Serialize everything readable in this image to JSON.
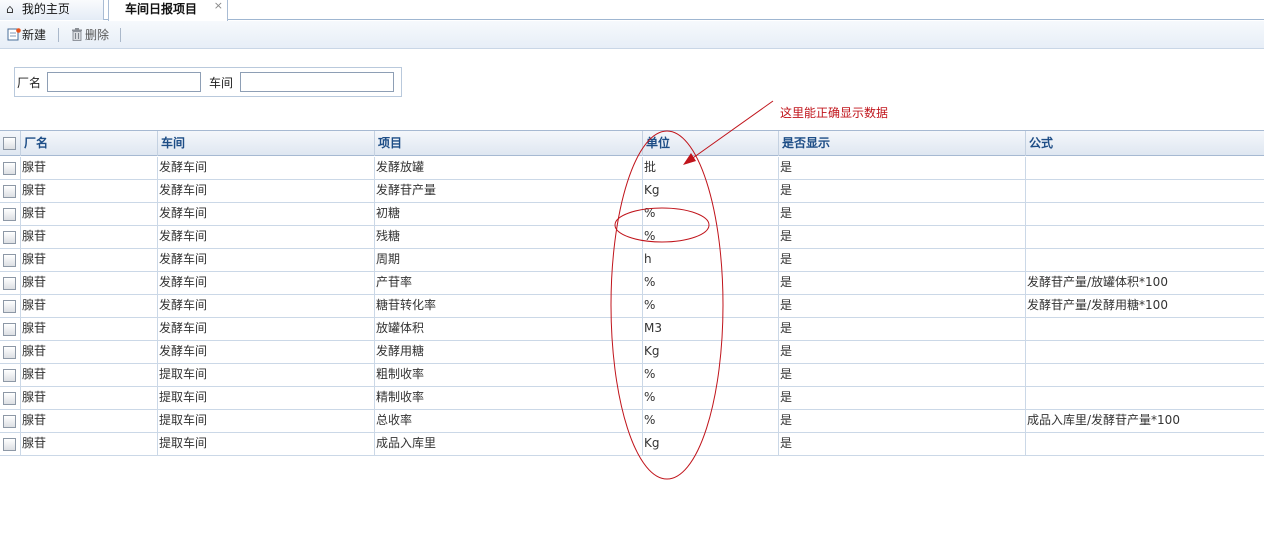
{
  "tabs": [
    {
      "label": "我的主页",
      "active": false
    },
    {
      "label": "车间日报项目",
      "active": true,
      "close": "×"
    }
  ],
  "toolbar": {
    "new_label": "新建",
    "delete_label": "删除"
  },
  "filter": {
    "factory_label": "厂名",
    "factory_value": "",
    "workshop_label": "车间",
    "workshop_value": ""
  },
  "grid": {
    "columns": [
      "厂名",
      "车间",
      "项目",
      "单位",
      "是否显示",
      "公式"
    ],
    "rows": [
      [
        "腺苷",
        "发酵车间",
        "发酵放罐",
        "批",
        "是",
        ""
      ],
      [
        "腺苷",
        "发酵车间",
        "发酵苷产量",
        "Kg",
        "是",
        ""
      ],
      [
        "腺苷",
        "发酵车间",
        "初糖",
        "%",
        "是",
        ""
      ],
      [
        "腺苷",
        "发酵车间",
        "残糖",
        "%",
        "是",
        ""
      ],
      [
        "腺苷",
        "发酵车间",
        "周期",
        "h",
        "是",
        ""
      ],
      [
        "腺苷",
        "发酵车间",
        "产苷率",
        "%",
        "是",
        "发酵苷产量/放罐体积*100"
      ],
      [
        "腺苷",
        "发酵车间",
        "糖苷转化率",
        "%",
        "是",
        "发酵苷产量/发酵用糖*100"
      ],
      [
        "腺苷",
        "发酵车间",
        "放罐体积",
        "M3",
        "是",
        ""
      ],
      [
        "腺苷",
        "发酵车间",
        "发酵用糖",
        "Kg",
        "是",
        ""
      ],
      [
        "腺苷",
        "提取车间",
        "粗制收率",
        "%",
        "是",
        ""
      ],
      [
        "腺苷",
        "提取车间",
        "精制收率",
        "%",
        "是",
        ""
      ],
      [
        "腺苷",
        "提取车间",
        "总收率",
        "%",
        "是",
        "成品入库里/发酵苷产量*100"
      ],
      [
        "腺苷",
        "提取车间",
        "成品入库里",
        "Kg",
        "是",
        ""
      ]
    ]
  },
  "annotation": {
    "text": "这里能正确显示数据",
    "color": "#c0141b"
  },
  "colors": {
    "header_text": "#1d4d86",
    "grid_line": "#cbd8e7"
  }
}
